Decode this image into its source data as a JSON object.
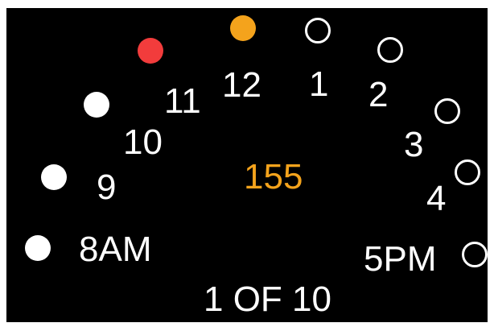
{
  "center_value": "155",
  "center_color": "#f4a31c",
  "pager_text": "1 OF 10",
  "hours": [
    {
      "label": "8AM",
      "state": "filled",
      "color": "#ffffff"
    },
    {
      "label": "9",
      "state": "filled",
      "color": "#ffffff"
    },
    {
      "label": "10",
      "state": "filled",
      "color": "#ffffff"
    },
    {
      "label": "11",
      "state": "filled",
      "color": "#f23c3c"
    },
    {
      "label": "12",
      "state": "filled",
      "color": "#f4a31c"
    },
    {
      "label": "1",
      "state": "empty",
      "color": "#ffffff"
    },
    {
      "label": "2",
      "state": "empty",
      "color": "#ffffff"
    },
    {
      "label": "3",
      "state": "empty",
      "color": "#ffffff"
    },
    {
      "label": "4",
      "state": "empty",
      "color": "#ffffff"
    },
    {
      "label": "5PM",
      "state": "empty",
      "color": "#ffffff"
    }
  ]
}
